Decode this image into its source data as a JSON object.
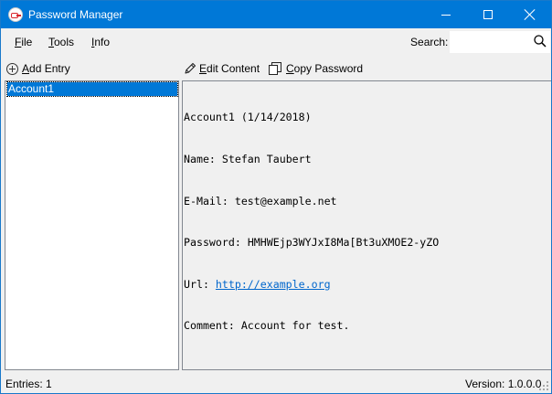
{
  "window": {
    "title": "Password Manager"
  },
  "menu": {
    "file_acc": "F",
    "file_rest": "ile",
    "tools_acc": "T",
    "tools_rest": "ools",
    "info_acc": "I",
    "info_rest": "nfo"
  },
  "search": {
    "label_acc": "S",
    "label_rest": "earch:",
    "value": "",
    "icon": "search-icon"
  },
  "left_toolbar": {
    "add_acc": "A",
    "add_rest": "dd Entry",
    "icon": "plus-circle-icon"
  },
  "entries": [
    {
      "label": "Account1",
      "selected": true
    }
  ],
  "right_toolbar": {
    "edit_acc": "E",
    "edit_rest": "dit Content",
    "edit_icon": "pencil-icon",
    "copy_acc": "C",
    "copy_rest": "opy Password",
    "copy_icon": "copy-icon"
  },
  "details": {
    "header": "Account1 (1/14/2018)",
    "name_label": "Name: ",
    "name": "Stefan Taubert",
    "email_label": "E-Mail: ",
    "email": "test@example.net",
    "password_label": "Password: ",
    "password": "HMHWEjp3WYJxI8Ma[Bt3uXMOE2-yZO",
    "url_label": "Url: ",
    "url": "http://example.org",
    "comment_label": "Comment: ",
    "comment": "Account for test."
  },
  "status": {
    "entries": "Entries: 1",
    "version": "Version: 1.0.0.0"
  },
  "colors": {
    "titlebar": "#0078d7",
    "selection": "#0078d7",
    "link": "#0066cc",
    "chrome": "#f0f0f0"
  }
}
